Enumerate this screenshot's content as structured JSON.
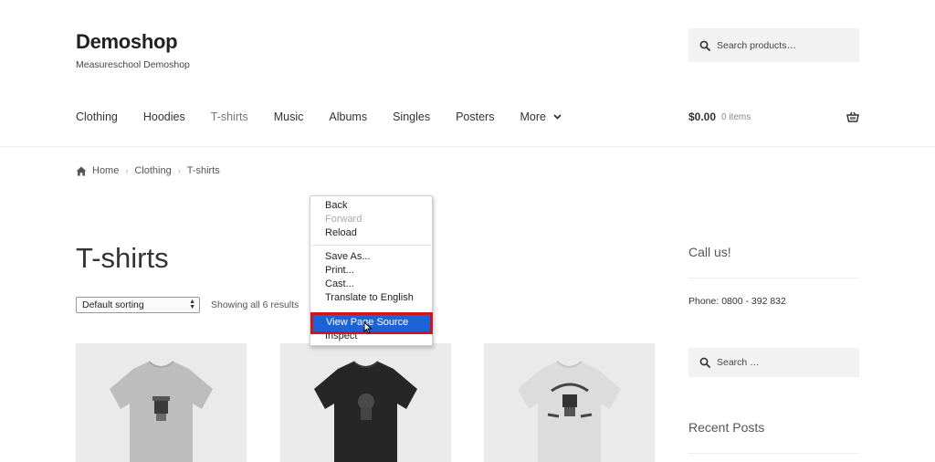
{
  "site": {
    "title": "Demoshop",
    "description": "Measureschool Demoshop"
  },
  "header_search": {
    "placeholder": "Search products…"
  },
  "nav": {
    "items": [
      "Clothing",
      "Hoodies",
      "T-shirts",
      "Music",
      "Albums",
      "Singles",
      "Posters"
    ],
    "active": "T-shirts",
    "more_label": "More"
  },
  "cart": {
    "amount": "$0.00",
    "count": "0 items"
  },
  "breadcrumb": {
    "items": [
      "Home",
      "Clothing",
      "T-shirts"
    ]
  },
  "page": {
    "title": "T-shirts"
  },
  "sorting": {
    "selected": "Default sorting",
    "result_count": "Showing all 6 results"
  },
  "sidebar": {
    "call_heading": "Call us!",
    "phone": "Phone: 0800 - 392 832",
    "search_placeholder": "Search …",
    "recent_heading": "Recent Posts"
  },
  "context_menu": {
    "items": [
      "Back",
      "Forward",
      "Reload",
      "Save As...",
      "Print...",
      "Cast...",
      "Translate to English",
      "View Page Source",
      "Inspect"
    ],
    "highlighted": "View Page Source",
    "disabled": "Forward"
  },
  "colors": {
    "highlight_bg": "#1d63d8",
    "highlight_border": "#d1161b"
  }
}
